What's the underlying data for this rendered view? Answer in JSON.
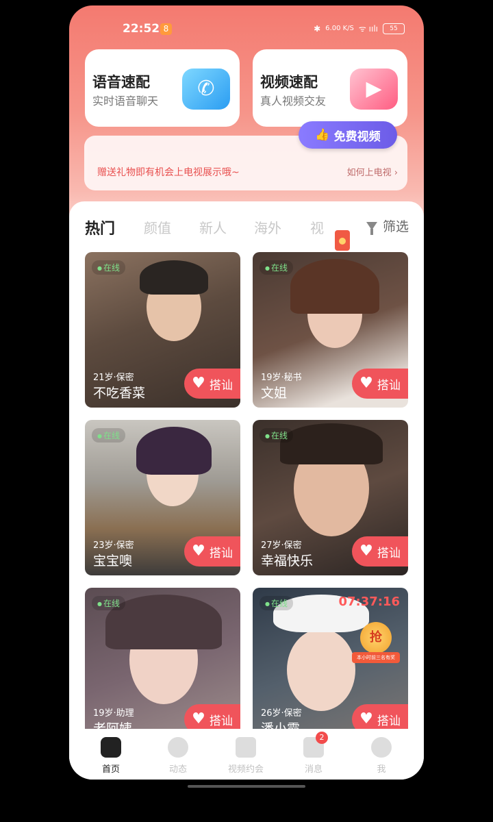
{
  "status_bar": {
    "time": "22:52",
    "app_badge": "8",
    "net": "6.00\nK/S",
    "signal": "ᯤ ıılı",
    "battery": "55"
  },
  "cards": [
    {
      "title": "语音速配",
      "subtitle": "实时语音聊天",
      "icon": "phone-icon"
    },
    {
      "title": "视频速配",
      "subtitle": "真人视频交友",
      "icon": "video-play-icon"
    }
  ],
  "free_video": {
    "label": "免费视频"
  },
  "banner": {
    "text": "赠送礼物即有机会上电视展示哦~",
    "link": "如何上电视 ›"
  },
  "tabs": [
    {
      "label": "热门",
      "active": true
    },
    {
      "label": "颜值"
    },
    {
      "label": "新人"
    },
    {
      "label": "海外"
    },
    {
      "label": "视"
    }
  ],
  "filter": {
    "label": "筛选"
  },
  "online_label": "在线",
  "chat_label": "搭讪",
  "profiles": [
    {
      "meta": "21岁·保密",
      "name": "不吃香菜",
      "online": true
    },
    {
      "meta": "19岁·秘书",
      "name": "文姐",
      "online": true
    },
    {
      "meta": "23岁·保密",
      "name": "宝宝噢",
      "online": true
    },
    {
      "meta": "27岁·保密",
      "name": "幸福快乐",
      "online": true
    },
    {
      "meta": "19岁·助理",
      "name": "老阿姨",
      "online": true
    },
    {
      "meta": "26岁·保密",
      "name": "潘小霞",
      "online": true,
      "timer": "07:37:16",
      "grab_label": "抢",
      "grab_ribbon": "本小时前三名有奖"
    }
  ],
  "tabbar": [
    {
      "label": "首页",
      "icon": "home-icon",
      "active": true
    },
    {
      "label": "动态",
      "icon": "pen-icon"
    },
    {
      "label": "视频约会",
      "icon": "video-icon"
    },
    {
      "label": "消息",
      "icon": "message-icon",
      "badge": "2"
    },
    {
      "label": "我",
      "icon": "profile-icon"
    }
  ],
  "colors": {
    "accent": "#f0545b",
    "top_gradient": "#f47a70",
    "online": "#7fe08a"
  }
}
